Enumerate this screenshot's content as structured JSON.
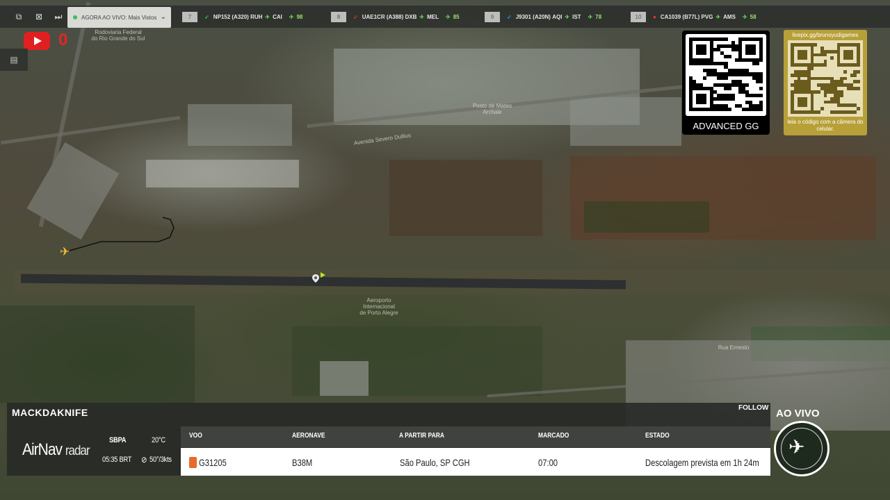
{
  "topbar": {
    "live_label": "AGORA AO VIVO",
    "live_sublabel": "Mais Vistos",
    "tickers": [
      {
        "rank": "7",
        "flight": "NP152 (A320)",
        "from": "RUH",
        "to": "CAI",
        "value": "98",
        "mark_color": "#3aa655"
      },
      {
        "rank": "8",
        "flight": "UAE1CR (A388)",
        "from": "DXB",
        "to": "MEL",
        "value": "85",
        "mark_color": "#d32f2f"
      },
      {
        "rank": "9",
        "flight": "J9301 (A20N)",
        "from": "AQI",
        "to": "IST",
        "value": "78",
        "mark_color": "#1e88e5"
      },
      {
        "rank": "10",
        "flight": "CA1039 (B77L)",
        "from": "PVG",
        "to": "AMS",
        "value": "58",
        "mark_color": "#e53935"
      }
    ]
  },
  "youtube": {
    "count": "0"
  },
  "map_labels": {
    "rodoviaria": "Rodoviaria Federal\ndo Rio Grande do Sul",
    "airport": "Aeroporto\nInternacional\nde Porto Alegre",
    "posto": "Posto de Mateo\nArchale",
    "rua": "Rua Ernesto",
    "anel": "Avenida Severo Dullius"
  },
  "qr": {
    "advanced_label": "ADVANCED GG",
    "pix_url": "livepix.gg/brunoyudigames",
    "pix_caption": "leia o código com a câmera do celular."
  },
  "panel": {
    "operator": "MACKDAKNIFE",
    "follow": "FOLLOW",
    "brand_main": "AirNav",
    "brand_sub": "radar",
    "airport_code": "SBPA",
    "local_time": "05:35 BRT",
    "temperature": "20°C",
    "wind": "50°/3kts",
    "headers": {
      "flight": "VOO",
      "aircraft": "AERONAVE",
      "destination": "A PARTIR PARA",
      "scheduled": "MARCADO",
      "status": "ESTADO"
    },
    "row": {
      "flight": "G31205",
      "aircraft": "B38M",
      "destination": "São Paulo, SP CGH",
      "scheduled": "07:00",
      "status": "Descolagem prevista em 1h 24m"
    }
  },
  "live_badge": "AO VIVO",
  "colors": {
    "accent_live": "#39c05b",
    "youtube_red": "#e02020",
    "aircraft": "#f2c230"
  }
}
